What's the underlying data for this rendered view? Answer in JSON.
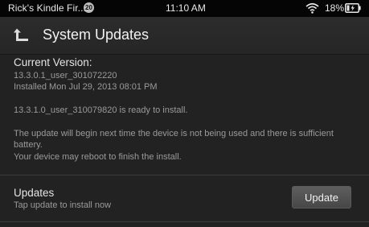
{
  "status_bar": {
    "device_name": "Rick's Kindle Fir...",
    "notification_count": "20",
    "time": "11:10 AM",
    "battery_percent": "18%",
    "wifi_icon": "wifi-icon",
    "battery_icon": "battery-charging-icon"
  },
  "header": {
    "back_icon": "back-arrow-icon",
    "title": "System Updates"
  },
  "current_version": {
    "heading": "Current Version:",
    "version": "13.3.0.1_user_301072220",
    "installed": "Installed Mon Jul 29, 2013 08:01 PM",
    "ready_message": "13.3.1.0_user_310079820 is ready to install.",
    "info_line_1": "The update will begin next time the device is not being used and there is sufficient",
    "info_line_2": "battery.",
    "reboot_note": "Your device may reboot to finish the install."
  },
  "updates": {
    "heading": "Updates",
    "subtext": "Tap update to install now",
    "button_label": "Update"
  },
  "colors": {
    "background": "#222222",
    "status_bar": "#050505",
    "title_bar": "#2a2a2a",
    "primary_text": "#e4e4e4",
    "secondary_text": "#9a9a9a",
    "button": "#525252"
  }
}
